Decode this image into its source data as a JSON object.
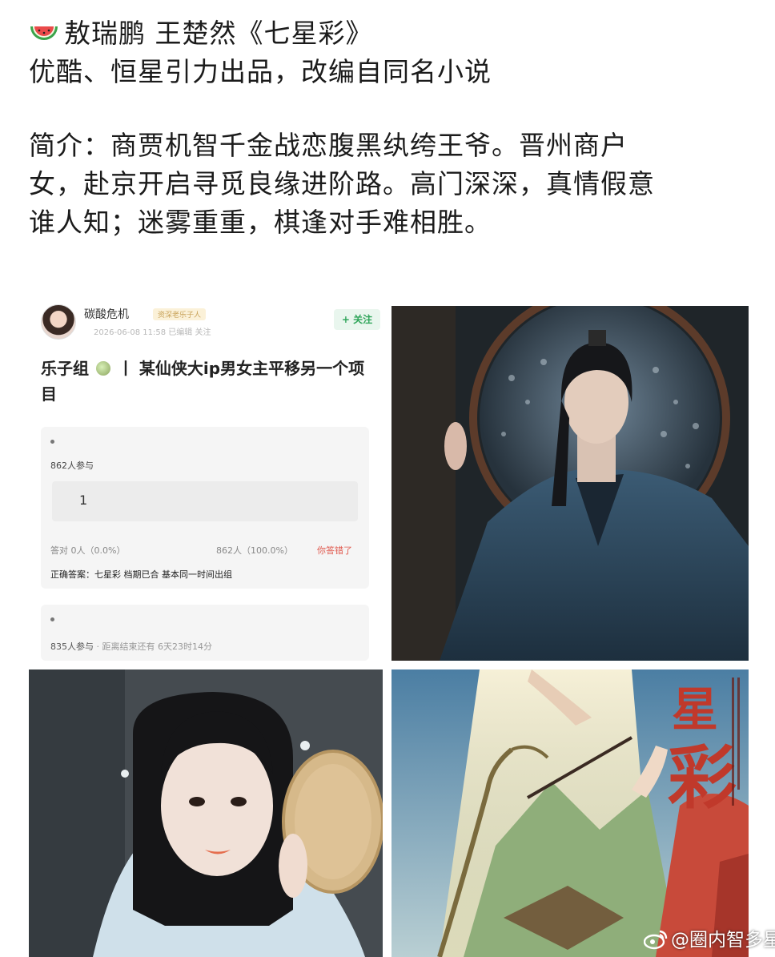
{
  "post": {
    "icon": "watermelon-icon",
    "title_line": "敖瑞鹏 王楚然《七星彩》",
    "producer_line": "优酷、恒星引力出品，改编自同名小说",
    "intro_lines": [
      "简介：商贾机智千金战恋腹黑纨绔王爷。晋州商户",
      "女，赴京开启寻觅良缘进阶路。高门深深，真情假意",
      "谁人知；迷雾重重，棋逢对手难相胜。"
    ]
  },
  "forum_screenshot": {
    "username": "碳酸危机",
    "badge": "资深老乐子人",
    "meta": "2026-06-08 11:58 已编辑 关注",
    "follow_label": "+ 关注",
    "title_prefix": "乐子组",
    "title_divider": "丨",
    "title_main": "某仙侠大ip男女主平移另一个项目",
    "poll_1": {
      "participants": "862人参与",
      "option": "1",
      "right_stat": "答对 0人（0.0%）",
      "wrong_stat": "862人（100.0%）",
      "verdict": "你答错了",
      "answer": "正确答案：七星彩 档期已合 基本同一时间出组"
    },
    "poll_2": {
      "participants": "835人参与",
      "remaining": "· 距离结束还有 6天23时14分"
    }
  },
  "images": {
    "actor": "actor-portrait",
    "actress": "actress-portrait",
    "poster": "poster-artwork",
    "poster_title_chars": "星彩"
  },
  "credit": {
    "icon": "weibo-icon",
    "text": "@圈内智多星"
  },
  "colors": {
    "text": "#1b1b1b",
    "follow_green": "#2fa55a",
    "wrong_red": "#e05a4f",
    "poster_red": "#c0392b"
  }
}
